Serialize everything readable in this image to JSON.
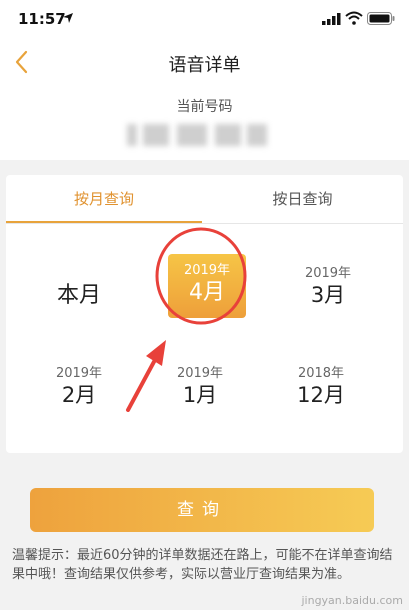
{
  "status_bar": {
    "time": "11:57"
  },
  "nav": {
    "title": "语音详单"
  },
  "number": {
    "label": "当前号码"
  },
  "tabs": [
    {
      "label": "按月查询",
      "active": true
    },
    {
      "label": "按日查询",
      "active": false
    }
  ],
  "months": {
    "this_month": "本月",
    "selected": {
      "year": "2019年",
      "month": "4月"
    },
    "items": [
      {
        "year": "2019年",
        "month": "3月"
      },
      {
        "year": "2019年",
        "month": "2月"
      },
      {
        "year": "2019年",
        "month": "1月"
      },
      {
        "year": "2018年",
        "month": "12月"
      }
    ]
  },
  "query_button": {
    "label": "查询"
  },
  "tip": "温馨提示：最近60分钟的详单数据还在路上，可能不在详单查询结果中哦！查询结果仅供参考，实际以营业厅查询结果为准。",
  "watermark": "jingyan.baidu.com",
  "colors": {
    "accent": "#e8a33b",
    "annotation": "#e8413a"
  }
}
